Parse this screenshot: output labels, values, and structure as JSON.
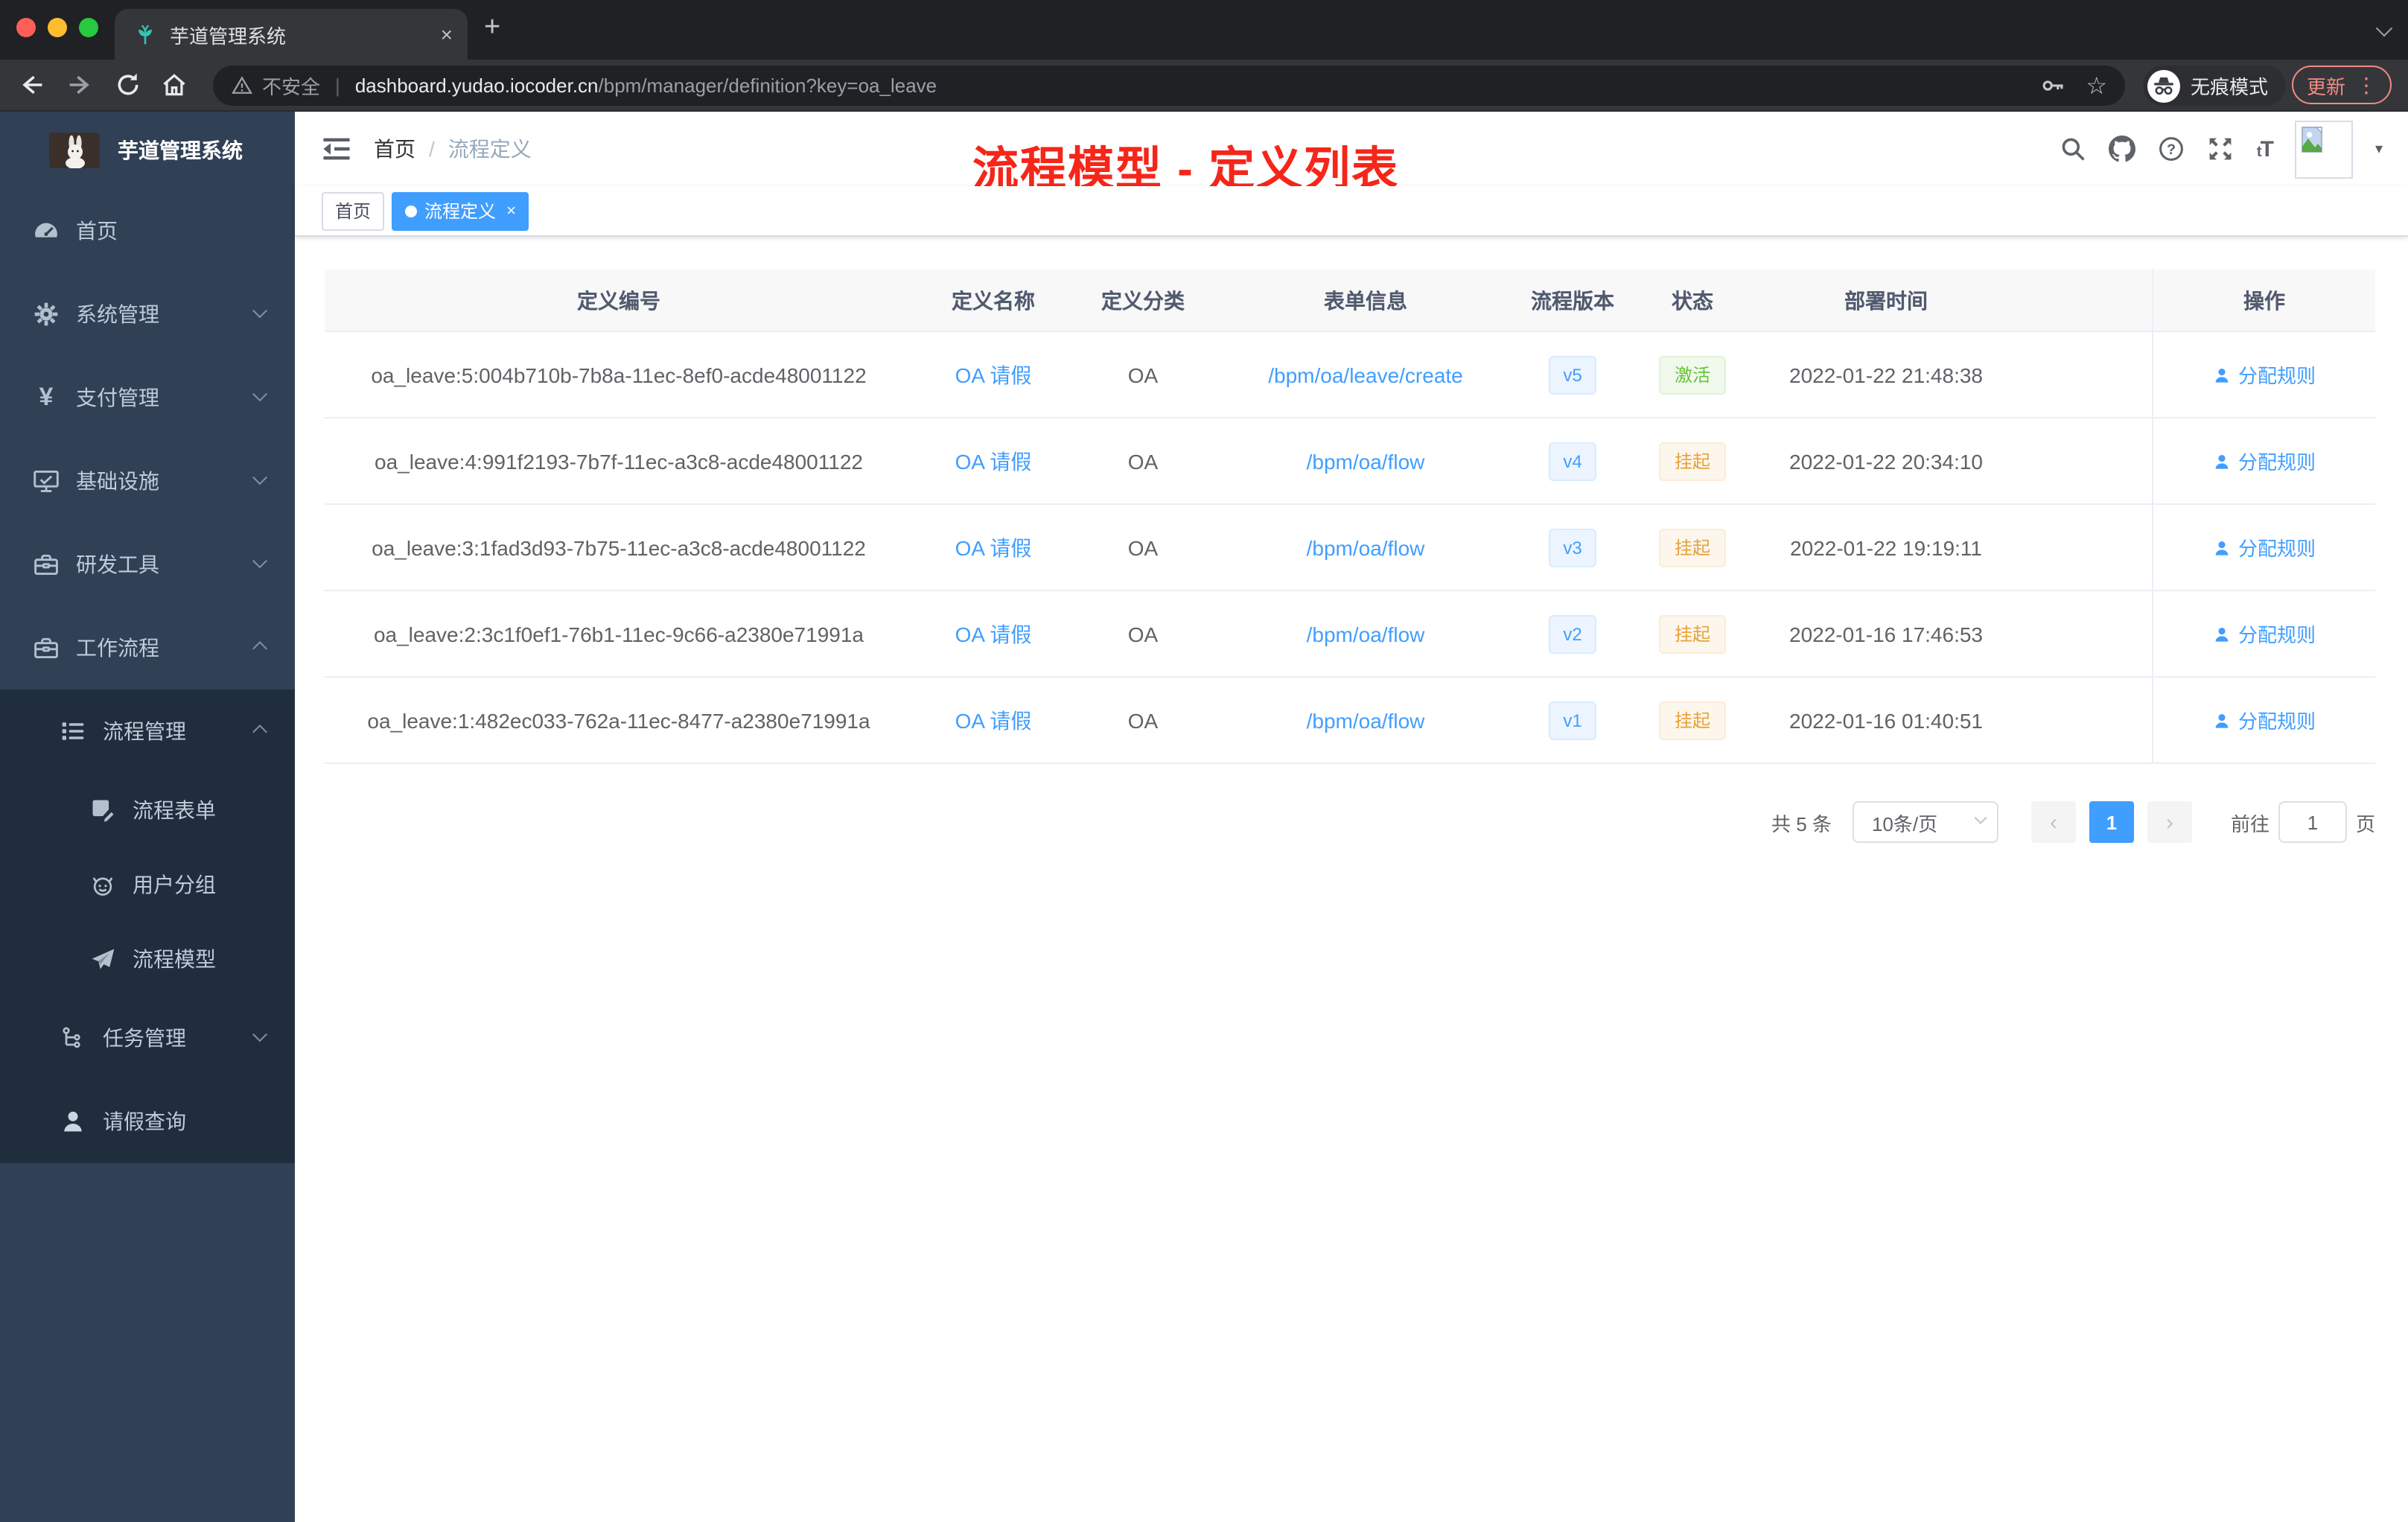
{
  "colors": {
    "accent": "#409eff",
    "annotation_red": "#f5261a",
    "sidebar_bg": "#304156",
    "submenu_bg": "#1f2d3d",
    "status_active": "#67c23a",
    "status_suspended": "#e6a23c"
  },
  "glyphs": {
    "close": "×",
    "new_tab": "+",
    "kebab": "⋮",
    "star": "☆",
    "divider": "|",
    "breadcrumb_sep": "/",
    "caret_down": "▾",
    "prev": "‹",
    "next": "›",
    "dot": "●",
    "font_small": "t",
    "font_big": "T"
  },
  "browser": {
    "tab_title": "芋道管理系统",
    "security_label": "不安全",
    "url_host": "dashboard.yudao.iocoder.cn",
    "url_path": "/bpm/manager/definition?key=oa_leave",
    "incognito_label": "无痕模式",
    "update_label": "更新"
  },
  "sidebar": {
    "title": "芋道管理系统",
    "items": [
      {
        "label": "首页"
      },
      {
        "label": "系统管理"
      },
      {
        "label": "支付管理"
      },
      {
        "label": "基础设施"
      },
      {
        "label": "研发工具"
      },
      {
        "label": "工作流程"
      },
      {
        "label": "流程管理"
      },
      {
        "label": "流程表单"
      },
      {
        "label": "用户分组"
      },
      {
        "label": "流程模型"
      },
      {
        "label": "任务管理"
      },
      {
        "label": "请假查询"
      }
    ]
  },
  "header": {
    "breadcrumb": [
      "首页",
      "流程定义"
    ],
    "annotation": "流程模型 - 定义列表"
  },
  "tags": [
    {
      "label": "首页"
    },
    {
      "label": "流程定义"
    }
  ],
  "table": {
    "columns": [
      "定义编号",
      "定义名称",
      "定义分类",
      "表单信息",
      "流程版本",
      "状态",
      "部署时间",
      "操作"
    ],
    "rows": [
      {
        "id": "oa_leave:5:004b710b-7b8a-11ec-8ef0-acde48001122",
        "name": "OA 请假",
        "category": "OA",
        "form": "/bpm/oa/leave/create",
        "version": "v5",
        "status": "激活",
        "status_class": "success",
        "time": "2022-01-22 21:48:38",
        "action": "分配规则"
      },
      {
        "id": "oa_leave:4:991f2193-7b7f-11ec-a3c8-acde48001122",
        "name": "OA 请假",
        "category": "OA",
        "form": "/bpm/oa/flow",
        "version": "v4",
        "status": "挂起",
        "status_class": "warning",
        "time": "2022-01-22 20:34:10",
        "action": "分配规则"
      },
      {
        "id": "oa_leave:3:1fad3d93-7b75-11ec-a3c8-acde48001122",
        "name": "OA 请假",
        "category": "OA",
        "form": "/bpm/oa/flow",
        "version": "v3",
        "status": "挂起",
        "status_class": "warning",
        "time": "2022-01-22 19:19:11",
        "action": "分配规则"
      },
      {
        "id": "oa_leave:2:3c1f0ef1-76b1-11ec-9c66-a2380e71991a",
        "name": "OA 请假",
        "category": "OA",
        "form": "/bpm/oa/flow",
        "version": "v2",
        "status": "挂起",
        "status_class": "warning",
        "time": "2022-01-16 17:46:53",
        "action": "分配规则"
      },
      {
        "id": "oa_leave:1:482ec033-762a-11ec-8477-a2380e71991a",
        "name": "OA 请假",
        "category": "OA",
        "form": "/bpm/oa/flow",
        "version": "v1",
        "status": "挂起",
        "status_class": "warning",
        "time": "2022-01-16 01:40:51",
        "action": "分配规则"
      }
    ]
  },
  "pagination": {
    "total": "共 5 条",
    "page_size": "10条/页",
    "current_page": "1",
    "goto_label": "前往",
    "goto_value": "1",
    "unit_label": "页"
  },
  "icons": {
    "tab-favicon": "teal-plant",
    "security-icon": "warning-triangle",
    "url-key-icon": "key",
    "url-star-icon": "star-outline",
    "incognito-icon": "spy-hat-glasses",
    "collapse-sidebar-icon": "fold-menu",
    "navbar-icons": [
      "search",
      "github",
      "help-circle",
      "fullscreen",
      "font-size"
    ],
    "avatar": "broken-image-placeholder",
    "menu-icons": [
      "dashboard-gauge",
      "gear",
      "yen",
      "monitor",
      "toolbox",
      "briefcase",
      "ordered-list",
      "form-document",
      "robot-face",
      "paper-plane",
      "tree-branch",
      "person"
    ],
    "action-icon": "person"
  }
}
